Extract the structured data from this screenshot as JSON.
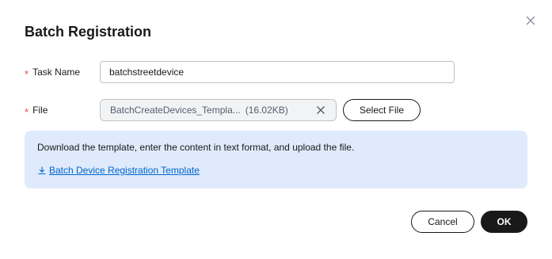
{
  "dialog": {
    "title": "Batch Registration",
    "close_icon": "close-icon"
  },
  "form": {
    "task_name": {
      "label": "Task Name",
      "required_mark": "*",
      "value": "batchstreetdevice"
    },
    "file": {
      "label": "File",
      "required_mark": "*",
      "file_name": "BatchCreateDevices_Templa...",
      "file_size": "(16.02KB)",
      "remove_icon": "close-icon",
      "select_button": "Select File"
    }
  },
  "info": {
    "text": "Download the template, enter the content in text format, and upload the file.",
    "link_icon": "download-icon",
    "link_text": "Batch Device Registration Template"
  },
  "footer": {
    "cancel_label": "Cancel",
    "ok_label": "OK"
  },
  "colors": {
    "required": "#e84e40",
    "info_background": "#dfeafc",
    "link": "#0066cc",
    "primary_button": "#191919"
  }
}
